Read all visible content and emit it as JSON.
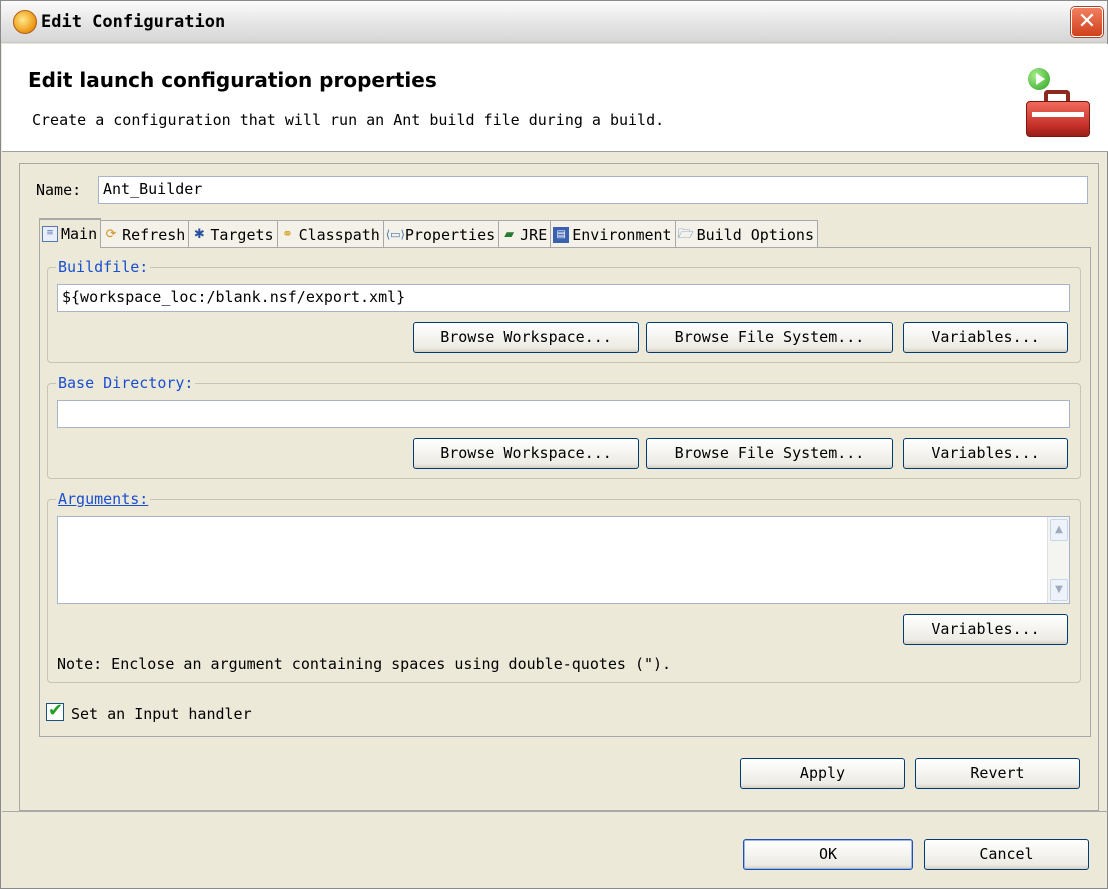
{
  "window": {
    "title": "Edit Configuration",
    "close_symbol": "✕"
  },
  "banner": {
    "title": "Edit launch configuration properties",
    "description": "Create a configuration that will run an Ant build file during a build."
  },
  "name_field": {
    "label": "Name:",
    "value": "Ant_Builder"
  },
  "tabs": [
    {
      "label": "Main",
      "icon": "main-tab-icon",
      "active": true
    },
    {
      "label": "Refresh",
      "icon": "refresh-icon"
    },
    {
      "label": "Targets",
      "icon": "targets-icon"
    },
    {
      "label": "Classpath",
      "icon": "classpath-icon"
    },
    {
      "label": "Properties",
      "icon": "properties-icon"
    },
    {
      "label": "JRE",
      "icon": "jre-icon"
    },
    {
      "label": "Environment",
      "icon": "environment-icon"
    },
    {
      "label": "Build Options",
      "icon": "folder-icon"
    }
  ],
  "buildfile": {
    "label": "Buildfile:",
    "value": "${workspace_loc:/blank.nsf/export.xml}",
    "browse_workspace": "Browse Workspace...",
    "browse_filesystem": "Browse File System...",
    "variables": "Variables..."
  },
  "base_directory": {
    "label": "Base Directory:",
    "value": "",
    "browse_workspace": "Browse Workspace...",
    "browse_filesystem": "Browse File System...",
    "variables": "Variables..."
  },
  "arguments": {
    "label": "Arguments:",
    "value": "",
    "variables": "Variables...",
    "note": "Note: Enclose an argument containing spaces using double-quotes (\")."
  },
  "input_handler": {
    "label": "Set an Input handler",
    "checked": true
  },
  "buttons": {
    "apply": "Apply",
    "revert": "Revert",
    "ok": "OK",
    "cancel": "Cancel"
  }
}
